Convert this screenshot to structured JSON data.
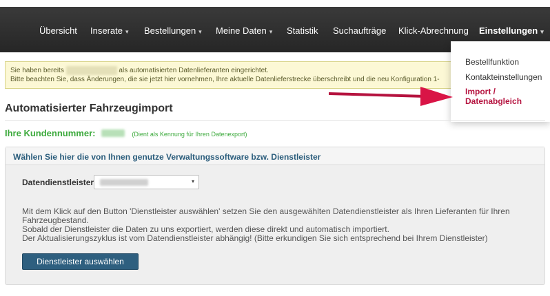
{
  "nav": {
    "items": [
      {
        "label": "Übersicht",
        "caret": false
      },
      {
        "label": "Inserate",
        "caret": true
      },
      {
        "label": "Bestellungen",
        "caret": true
      },
      {
        "label": "Meine Daten",
        "caret": true
      },
      {
        "label": "Statistik",
        "caret": false
      },
      {
        "label": "Suchaufträge",
        "caret": false
      },
      {
        "label": "Klick-Abrechnung",
        "caret": false
      },
      {
        "label": "Einstellungen",
        "caret": true,
        "active": true
      }
    ],
    "caret_glyph": "▾"
  },
  "dropdown": {
    "items": [
      {
        "label": "Bestellfunktion"
      },
      {
        "label": "Kontakteinstellungen"
      },
      {
        "label": "Import / Datenabgleich",
        "highlight": true
      }
    ]
  },
  "alert": {
    "line1_prefix": "Sie haben bereits",
    "line1_suffix": "als automatisierten Datenlieferanten eingerichtet.",
    "line2": "Bitte beachten Sie, dass Änderungen, die sie jetzt hier vornehmen, Ihre aktuelle Datenlieferstrecke überschreibt und die neu Konfiguration 1-"
  },
  "page": {
    "title": "Automatisierter Fahrzeugimport"
  },
  "customer": {
    "label": "Ihre Kundennummer:",
    "hint": "(Dient als Kennung für Ihren Datenexport)"
  },
  "panel": {
    "title": "Wählen Sie hier die von Ihnen genutze Verwaltungssoftware bzw. Dienstleister",
    "field_label": "Datendienstleister",
    "description": [
      "Mit dem Klick auf den Button 'Dienstleister auswählen' setzen Sie den ausgewählten Datendienstleister als Ihren Lieferanten für Ihren",
      "Fahrzeugbestand.",
      "Sobald der Dienstleister die Daten zu uns exportiert, werden diese direkt und automatisch importiert.",
      "Der Aktualisierungszyklus ist vom Datendienstleister abhängig! (Bitte erkundigen Sie sich entsprechend bei Ihrem Dienstleister)"
    ],
    "button_label": "Dienstleister auswählen"
  },
  "colors": {
    "navbar": "#2e2e2e",
    "accent_red": "#b5133f",
    "customer_green": "#3daa3d",
    "panel_title": "#2b5d7c",
    "button": "#2e5f7f",
    "alert_bg": "#fcf8d5"
  }
}
